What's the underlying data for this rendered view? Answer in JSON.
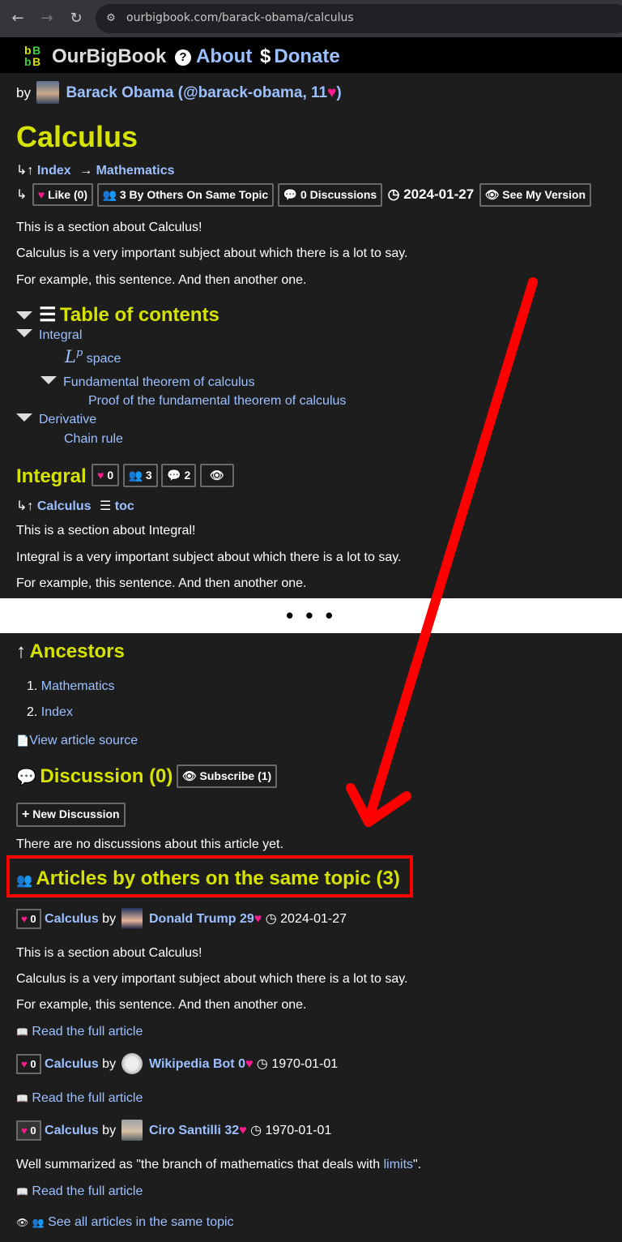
{
  "browser": {
    "url": "ourbigbook.com/barack-obama/calculus"
  },
  "site": {
    "name": "OurBigBook",
    "about": "About",
    "donate": "Donate"
  },
  "author": {
    "by": "by",
    "name": "Barack Obama (@barack-obama, 11",
    "close": ")"
  },
  "article": {
    "title": "Calculus",
    "breadcrumb_index": "Index",
    "breadcrumb_math": "Mathematics",
    "like_label": "Like (0)",
    "others_label": "3 By Others On Same Topic",
    "discussions_label": "0 Discussions",
    "date": "2024-01-27",
    "see_version_label": "See My Version",
    "p1": "This is a section about Calculus!",
    "p2": "Calculus is a very important subject about which there is a lot to say.",
    "p3": "For example, this sentence. And then another one."
  },
  "toc": {
    "heading": "Table of contents",
    "integral": "Integral",
    "lp_space": "space",
    "ftc": "Fundamental theorem of calculus",
    "ftc_proof": "Proof of the fundamental theorem of calculus",
    "derivative": "Derivative",
    "chain_rule": "Chain rule"
  },
  "integral": {
    "title": "Integral",
    "likes": "0",
    "others": "3",
    "discussions": "2",
    "crumb_calculus": "Calculus",
    "crumb_toc": "toc",
    "p1": "This is a section about Integral!",
    "p2": "Integral is a very important subject about which there is a lot to say.",
    "p3": "For example, this sentence. And then another one."
  },
  "gap": "• • •",
  "ancestors": {
    "heading": "Ancestors",
    "items": [
      "Mathematics",
      "Index"
    ],
    "view_source": "View article source"
  },
  "discussion": {
    "heading": "Discussion (0)",
    "subscribe": "Subscribe (1)",
    "new_discussion": "New Discussion",
    "empty": "There are no discussions about this article yet."
  },
  "others": {
    "heading": "Articles by others on the same topic (3)",
    "by": "by",
    "read_full": "Read the full article",
    "see_all": "See all articles in the same topic",
    "items": [
      {
        "likes": "0",
        "title": "Calculus",
        "author": "Donald Trump 29",
        "date": "2024-01-27",
        "p1": "This is a section about Calculus!",
        "p2": "Calculus is a very important subject about which there is a lot to say.",
        "p3": "For example, this sentence. And then another one."
      },
      {
        "likes": "0",
        "title": "Calculus",
        "author": "Wikipedia Bot 0",
        "date": "1970-01-01"
      },
      {
        "likes": "0",
        "title": "Calculus",
        "author": "Ciro Santilli 32",
        "date": "1970-01-01",
        "summary_pre": "Well summarized as \"the branch of mathematics that deals with ",
        "summary_link": "limits",
        "summary_post": "\"."
      }
    ]
  },
  "colors": {
    "heading_yellow": "#d6e300",
    "link_blue": "#9cc0ff",
    "heart_pink": "#ff1c8f",
    "annotation_red": "#ff0000"
  }
}
